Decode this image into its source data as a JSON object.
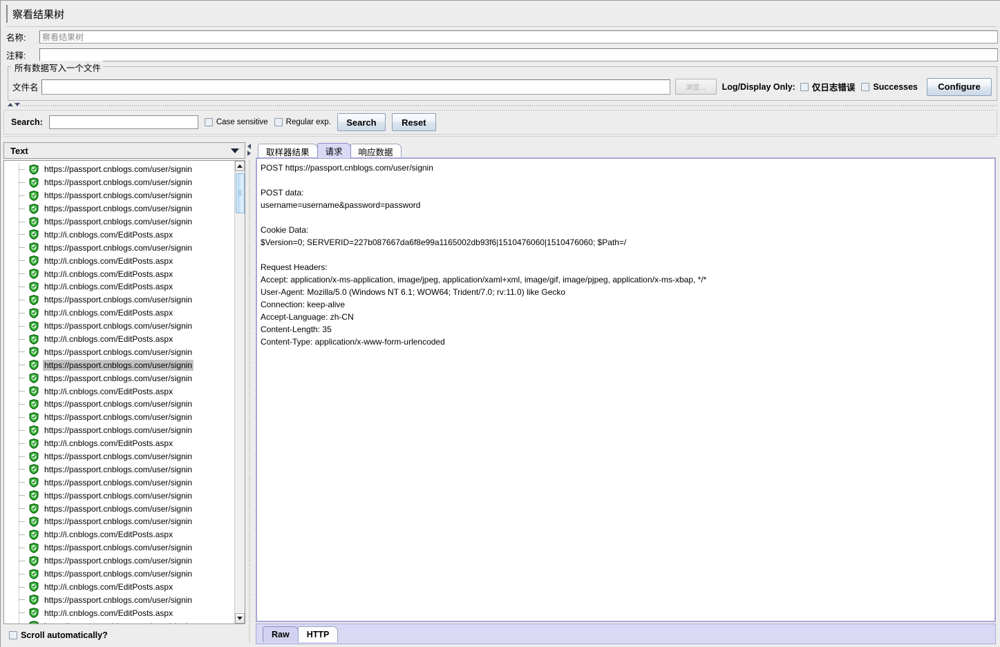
{
  "window": {
    "title": "察看结果树"
  },
  "form": {
    "name_label": "名称:",
    "name_value": "察看结果树",
    "comment_label": "注释:",
    "comment_value": ""
  },
  "filegroup": {
    "legend": "所有数据写入一个文件",
    "filename_label": "文件名",
    "filename_value": "",
    "browse_label": "浏览...",
    "log_display_label": "Log/Display Only:",
    "errors_only_label": "仅日志错误",
    "errors_only_checked": false,
    "successes_label": "Successes",
    "successes_checked": false,
    "configure_label": "Configure"
  },
  "search": {
    "label": "Search:",
    "value": "",
    "case_sensitive_label": "Case sensitive",
    "case_sensitive_checked": false,
    "regular_exp_label": "Regular exp.",
    "regular_exp_checked": false,
    "search_button": "Search",
    "reset_button": "Reset"
  },
  "tree": {
    "header_label": "Text",
    "scroll_automatically_label": "Scroll automatically?",
    "scroll_automatically_checked": false,
    "selected_index": 15,
    "items": [
      "https://passport.cnblogs.com/user/signin",
      "https://passport.cnblogs.com/user/signin",
      "https://passport.cnblogs.com/user/signin",
      "https://passport.cnblogs.com/user/signin",
      "https://passport.cnblogs.com/user/signin",
      "http://i.cnblogs.com/EditPosts.aspx",
      "https://passport.cnblogs.com/user/signin",
      "http://i.cnblogs.com/EditPosts.aspx",
      "http://i.cnblogs.com/EditPosts.aspx",
      "http://i.cnblogs.com/EditPosts.aspx",
      "https://passport.cnblogs.com/user/signin",
      "http://i.cnblogs.com/EditPosts.aspx",
      "https://passport.cnblogs.com/user/signin",
      "http://i.cnblogs.com/EditPosts.aspx",
      "https://passport.cnblogs.com/user/signin",
      "https://passport.cnblogs.com/user/signin",
      "https://passport.cnblogs.com/user/signin",
      "http://i.cnblogs.com/EditPosts.aspx",
      "https://passport.cnblogs.com/user/signin",
      "https://passport.cnblogs.com/user/signin",
      "https://passport.cnblogs.com/user/signin",
      "http://i.cnblogs.com/EditPosts.aspx",
      "https://passport.cnblogs.com/user/signin",
      "https://passport.cnblogs.com/user/signin",
      "https://passport.cnblogs.com/user/signin",
      "https://passport.cnblogs.com/user/signin",
      "https://passport.cnblogs.com/user/signin",
      "https://passport.cnblogs.com/user/signin",
      "http://i.cnblogs.com/EditPosts.aspx",
      "https://passport.cnblogs.com/user/signin",
      "https://passport.cnblogs.com/user/signin",
      "https://passport.cnblogs.com/user/signin",
      "http://i.cnblogs.com/EditPosts.aspx",
      "https://passport.cnblogs.com/user/signin",
      "http://i.cnblogs.com/EditPosts.aspx",
      "https://passport.cnblogs.com/user/signin"
    ]
  },
  "result": {
    "tabs": [
      {
        "label": "取样器结果",
        "active": false
      },
      {
        "label": "请求",
        "active": true
      },
      {
        "label": "响应数据",
        "active": false
      }
    ],
    "body": "POST https://passport.cnblogs.com/user/signin\n\nPOST data:\nusername=username&password=password\n\nCookie Data:\n$Version=0; SERVERID=227b087667da6f8e99a1165002db93f6|1510476060|1510476060; $Path=/\n\nRequest Headers:\nAccept: application/x-ms-application, image/jpeg, application/xaml+xml, image/gif, image/pjpeg, application/x-ms-xbap, */*\nUser-Agent: Mozilla/5.0 (Windows NT 6.1; WOW64; Trident/7.0; rv:11.0) like Gecko\nConnection: keep-alive\nAccept-Language: zh-CN\nContent-Length: 35\nContent-Type: application/x-www-form-urlencoded",
    "bottom_tabs": [
      {
        "label": "Raw",
        "active": true
      },
      {
        "label": "HTTP",
        "active": false
      }
    ]
  },
  "colors": {
    "accent": "#d9d9f5",
    "shield_green": "#2aa02a",
    "selection": "#c3c3c3",
    "panel_bg": "#ededed"
  }
}
